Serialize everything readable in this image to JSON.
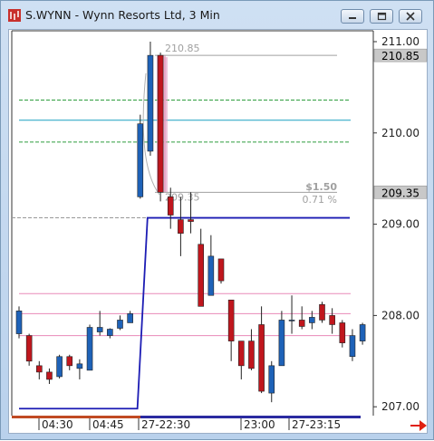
{
  "window": {
    "title": "S.WYNN - Wynn Resorts Ltd, 3 Min",
    "icon": "chart-app-icon",
    "buttons": [
      "minimize",
      "maximize",
      "close"
    ]
  },
  "chart_data": {
    "type": "candlestick",
    "title": "",
    "ylim": [
      206.95,
      211.1
    ],
    "y_ticks": [
      "211.00",
      "210.00",
      "209.00",
      "208.00",
      "207.00"
    ],
    "x_ticks": [
      "04:30",
      "04:45",
      "27-22:30",
      "23:00",
      "27-23:15"
    ],
    "price_flags": [
      {
        "label": "210.85",
        "value": 210.85
      },
      {
        "label": "209.35",
        "value": 209.35
      }
    ],
    "candles": [
      {
        "o": 207.8,
        "h": 208.1,
        "l": 207.75,
        "c": 208.05
      },
      {
        "o": 207.78,
        "h": 207.8,
        "l": 207.45,
        "c": 207.5
      },
      {
        "o": 207.45,
        "h": 207.5,
        "l": 207.3,
        "c": 207.38
      },
      {
        "o": 207.38,
        "h": 207.42,
        "l": 207.25,
        "c": 207.3
      },
      {
        "o": 207.33,
        "h": 207.57,
        "l": 207.31,
        "c": 207.55
      },
      {
        "o": 207.55,
        "h": 207.57,
        "l": 207.4,
        "c": 207.45
      },
      {
        "o": 207.42,
        "h": 207.52,
        "l": 207.3,
        "c": 207.47
      },
      {
        "o": 207.4,
        "h": 207.9,
        "l": 207.4,
        "c": 207.87
      },
      {
        "o": 207.82,
        "h": 208.05,
        "l": 207.78,
        "c": 207.87
      },
      {
        "o": 207.78,
        "h": 207.86,
        "l": 207.75,
        "c": 207.85
      },
      {
        "o": 207.86,
        "h": 208.0,
        "l": 207.84,
        "c": 207.95
      },
      {
        "o": 207.92,
        "h": 208.05,
        "l": 207.92,
        "c": 208.02
      },
      {
        "o": 209.3,
        "h": 210.2,
        "l": 209.28,
        "c": 210.1
      },
      {
        "o": 209.8,
        "h": 211.0,
        "l": 209.75,
        "c": 210.85
      },
      {
        "o": 210.85,
        "h": 210.88,
        "l": 209.25,
        "c": 209.35
      },
      {
        "o": 209.3,
        "h": 209.4,
        "l": 208.95,
        "c": 209.1
      },
      {
        "o": 209.05,
        "h": 209.3,
        "l": 208.65,
        "c": 208.9
      },
      {
        "o": 209.05,
        "h": 209.35,
        "l": 208.9,
        "c": 209.03
      },
      {
        "o": 208.78,
        "h": 208.95,
        "l": 208.1,
        "c": 208.1
      },
      {
        "o": 208.22,
        "h": 208.88,
        "l": 208.22,
        "c": 208.65
      },
      {
        "o": 208.62,
        "h": 208.62,
        "l": 208.35,
        "c": 208.38
      },
      {
        "o": 208.17,
        "h": 208.17,
        "l": 207.5,
        "c": 207.72
      },
      {
        "o": 207.72,
        "h": 207.72,
        "l": 207.3,
        "c": 207.45
      },
      {
        "o": 207.72,
        "h": 207.85,
        "l": 207.4,
        "c": 207.42
      },
      {
        "o": 207.9,
        "h": 208.1,
        "l": 207.15,
        "c": 207.17
      },
      {
        "o": 207.15,
        "h": 207.5,
        "l": 207.05,
        "c": 207.45
      },
      {
        "o": 207.45,
        "h": 208.05,
        "l": 207.45,
        "c": 207.95
      },
      {
        "o": 207.95,
        "h": 208.22,
        "l": 207.8,
        "c": 207.95
      },
      {
        "o": 207.95,
        "h": 208.1,
        "l": 207.85,
        "c": 207.88
      },
      {
        "o": 207.92,
        "h": 208.05,
        "l": 207.85,
        "c": 207.98
      },
      {
        "o": 208.12,
        "h": 208.15,
        "l": 207.92,
        "c": 207.95
      },
      {
        "o": 208.0,
        "h": 208.08,
        "l": 207.8,
        "c": 207.9
      },
      {
        "o": 207.92,
        "h": 207.95,
        "l": 207.65,
        "c": 207.7
      },
      {
        "o": 207.55,
        "h": 207.85,
        "l": 207.5,
        "c": 207.78
      },
      {
        "o": 207.72,
        "h": 207.92,
        "l": 207.68,
        "c": 207.9
      }
    ],
    "h_lines": [
      {
        "value": 210.36,
        "color": "#2e9e3e",
        "style": "dashed"
      },
      {
        "value": 210.14,
        "color": "#1aa0c0",
        "style": "solid"
      },
      {
        "value": 209.9,
        "color": "#2e9e3e",
        "style": "dashed"
      },
      {
        "value": 209.07,
        "color": "#999999",
        "style": "dashed"
      },
      {
        "value": 208.24,
        "color": "#e88ab8",
        "style": "solid"
      },
      {
        "value": 208.02,
        "color": "#e88ab8",
        "style": "solid"
      },
      {
        "value": 207.78,
        "color": "#e88ab8",
        "style": "solid"
      }
    ],
    "step_line": {
      "color": "#1c1cb4",
      "points": [
        [
          0,
          206.98
        ],
        [
          11,
          206.98
        ],
        [
          12,
          209.07
        ],
        [
          34,
          209.07
        ]
      ]
    },
    "measurement": {
      "top_label": "210.85",
      "bottom_label": "209.35",
      "change": "$1.50",
      "change_pct": "0.71 %"
    }
  },
  "colors": {
    "up": "#1e62b8",
    "down": "#c0161d",
    "flag_bg": "#c8c8c8"
  }
}
